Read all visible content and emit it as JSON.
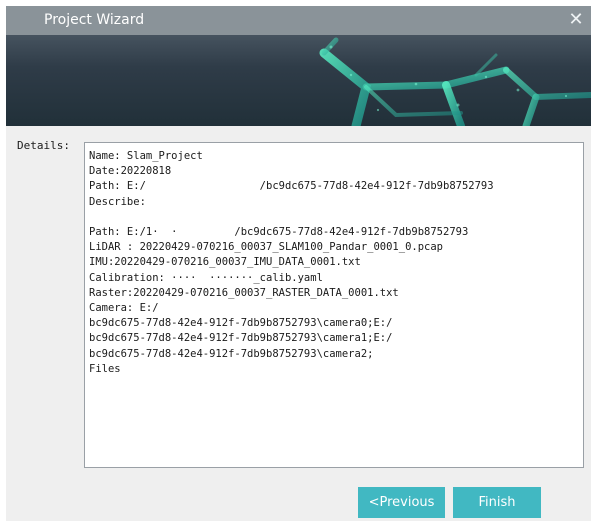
{
  "window": {
    "title": "Project Wizard",
    "close_icon": "close-icon"
  },
  "details": {
    "label": "Details:",
    "lines": [
      "Name: Slam_Project",
      "Date:20220818",
      "Path: E:/                  /bc9dc675-77d8-42e4-912f-7db9b8752793",
      "Describe:",
      "",
      "Path: E:/1·  ·         /bc9dc675-77d8-42e4-912f-7db9b8752793",
      "LiDAR : 20220429-070216_00037_SLAM100_Pandar_0001_0.pcap",
      "IMU:20220429-070216_00037_IMU_DATA_0001.txt",
      "Calibration: ····  ·······_calib.yaml",
      "Raster:20220429-070216_00037_RASTER_DATA_0001.txt",
      "Camera: E:/",
      "bc9dc675-77d8-42e4-912f-7db9b8752793\\camera0;E:/",
      "bc9dc675-77d8-42e4-912f-7db9b8752793\\camera1;E:/",
      "bc9dc675-77d8-42e4-912f-7db9b8752793\\camera2;",
      "Files"
    ]
  },
  "buttons": {
    "previous": "<Previous",
    "finish": "Finish"
  },
  "colors": {
    "titlebar": "#8a9399",
    "button": "#41b8c2",
    "banner": "#2f3c48"
  }
}
